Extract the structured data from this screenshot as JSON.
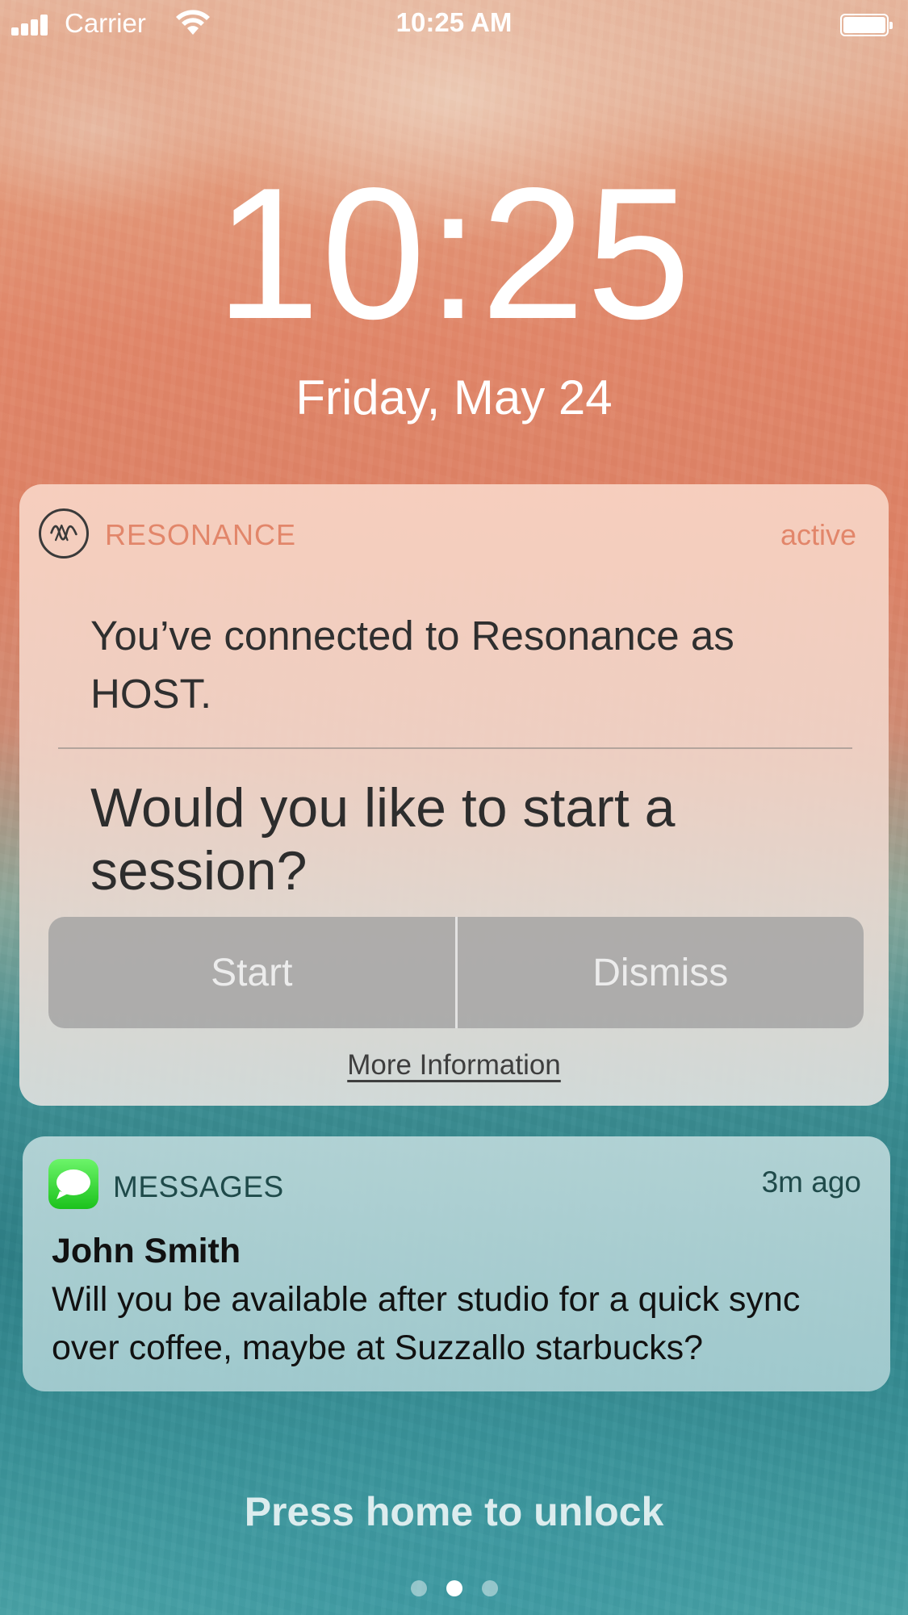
{
  "status_bar": {
    "carrier": "Carrier",
    "time": "10:25 AM",
    "signal_icon": "cellular-signal-icon",
    "wifi_icon": "wifi-icon",
    "battery_icon": "battery-icon",
    "battery_level": 1.0
  },
  "lock_screen": {
    "time": "10:25",
    "date": "Friday, May 24",
    "unlock_hint": "Press home to unlock",
    "page_count": 3,
    "active_page": 2
  },
  "notifications": {
    "resonance": {
      "app_name": "RESONANCE",
      "app_icon": "resonance-logo-icon",
      "status": "active",
      "message": "You’ve connected to Resonance as HOST.",
      "question": "Would you like to start a session?",
      "start_label": "Start",
      "dismiss_label": "Dismiss",
      "more_info_label": "More Information",
      "accent_color": "#e2866a"
    },
    "messages": {
      "app_name": "MESSAGES",
      "app_icon": "messages-bubble-icon",
      "time_ago": "3m ago",
      "sender": "John Smith",
      "text": "Will you be available after studio for a quick sync over coffee, maybe at Suzzallo starbucks?",
      "icon_color": "#2fd12f"
    }
  }
}
